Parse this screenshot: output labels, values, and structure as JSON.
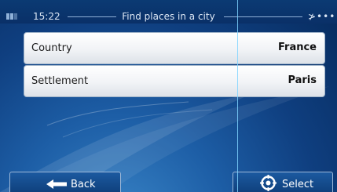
{
  "statusbar": {
    "time": "15:22",
    "title": "Find places in a city",
    "gps_indicator": "≯•••",
    "battery_icon": "battery-icon"
  },
  "rows": [
    {
      "label": "Country",
      "value": "France"
    },
    {
      "label": "Settlement",
      "value": "Paris"
    }
  ],
  "buttons": {
    "back_label": "Back",
    "back_icon": "back-arrow-icon",
    "select_label": "Select",
    "select_icon": "target-icon"
  },
  "colors": {
    "accent": "#0d3d78",
    "row_text": "#1b1b1b",
    "cursor_line": "#7fd4ff"
  }
}
